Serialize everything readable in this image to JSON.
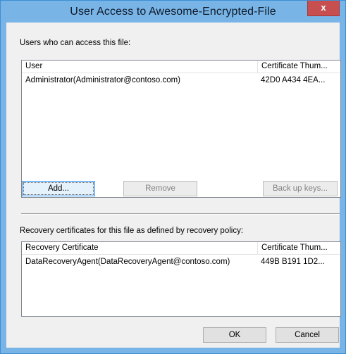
{
  "window": {
    "title": "User Access to Awesome-Encrypted-File",
    "close_glyph": "x"
  },
  "users_section": {
    "label": "Users who can access this file:",
    "columns": [
      "User",
      "Certificate Thum..."
    ],
    "rows": [
      {
        "user": "Administrator(Administrator@contoso.com)",
        "thumbprint": "42D0 A434 4EA..."
      }
    ]
  },
  "buttons": {
    "add": "Add...",
    "remove": "Remove",
    "backup": "Back up keys...",
    "ok": "OK",
    "cancel": "Cancel"
  },
  "recovery_section": {
    "label": "Recovery certificates for this file as defined by recovery policy:",
    "columns": [
      "Recovery Certificate",
      "Certificate Thum..."
    ],
    "rows": [
      {
        "certificate": "DataRecoveryAgent(DataRecoveryAgent@contoso.com)",
        "thumbprint": "449B B191 1D2..."
      }
    ]
  }
}
